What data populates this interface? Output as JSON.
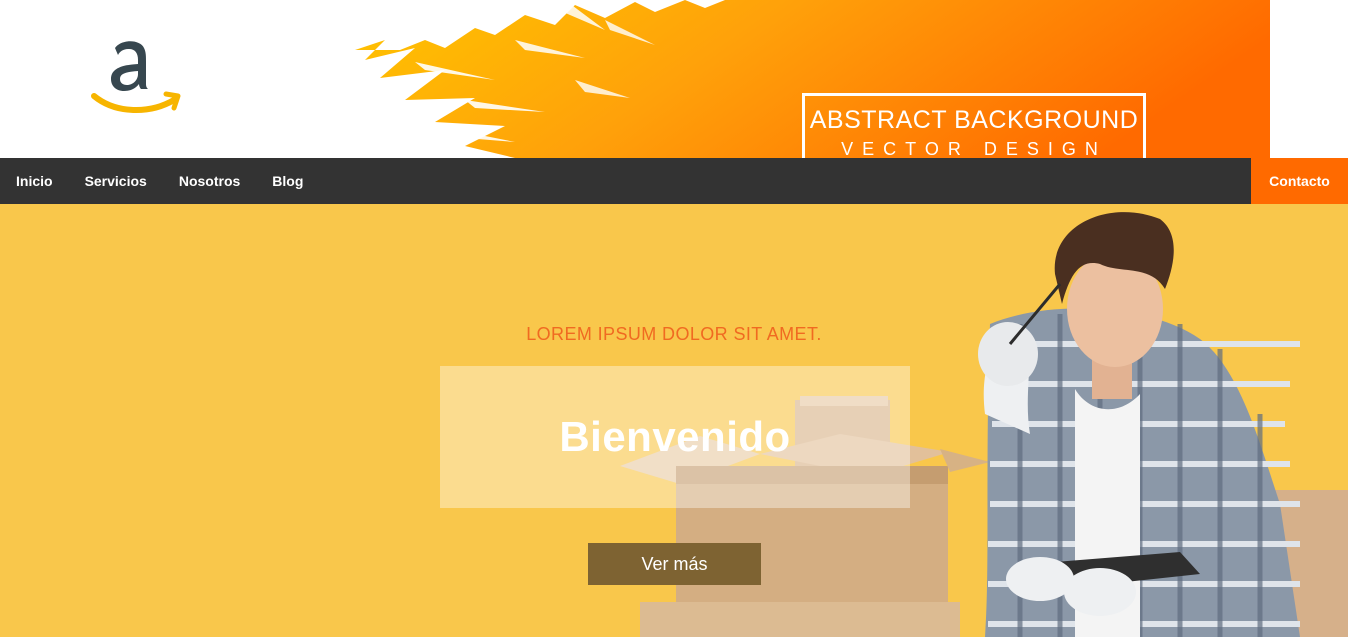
{
  "logo": {
    "icon": "amazon-logo-icon"
  },
  "banner": {
    "title": "ABSTRACT BACKGROUND",
    "subtitle": "VECTOR DESIGN"
  },
  "nav": {
    "items": [
      {
        "label": "Inicio"
      },
      {
        "label": "Servicios"
      },
      {
        "label": "Nosotros"
      },
      {
        "label": "Blog"
      }
    ],
    "contact_label": "Contacto"
  },
  "hero": {
    "eyebrow": "LOREM IPSUM DOLOR SIT AMET.",
    "title": "Bienvenido",
    "button_label": "Ver más"
  },
  "colors": {
    "nav_bg": "#333333",
    "accent": "#ff6a00",
    "hero_bg": "#f9c74b",
    "eyebrow": "#f06a21",
    "button_bg": "#7e6332",
    "logo_dark": "#37474f",
    "logo_smile": "#f7b500"
  }
}
